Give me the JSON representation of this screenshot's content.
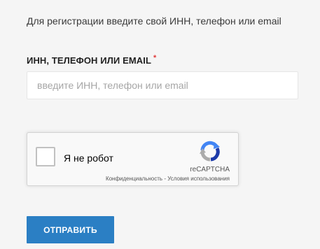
{
  "intro_text": "Для регистрации введите свой ИНН, телефон или email",
  "field": {
    "label": "ИНН, ТЕЛЕФОН ИЛИ EMAIL",
    "required_mark": "*",
    "placeholder": "введите ИНН, телефон или email",
    "value": ""
  },
  "recaptcha": {
    "checkbox_label": "Я не робот",
    "checked": false,
    "brand": "reCAPTCHA",
    "privacy_link": "Конфиденциальность",
    "separator": " - ",
    "terms_link": "Условия использования",
    "icon": "recaptcha-logo-icon"
  },
  "submit": {
    "label": "ОТПРАВИТЬ"
  },
  "colors": {
    "background": "#f5f5f5",
    "button": "#2b7fc4",
    "required": "#e03a3a",
    "recaptcha_blue_dark": "#1c3aa9",
    "recaptcha_blue": "#4285f4",
    "recaptcha_gray": "#ababab"
  }
}
